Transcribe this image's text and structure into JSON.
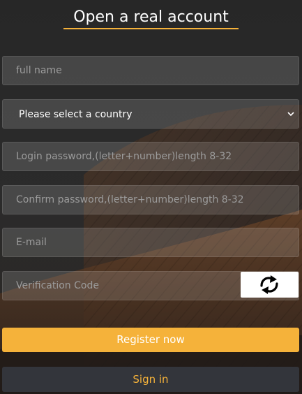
{
  "header": {
    "title": "Open a real account"
  },
  "form": {
    "full_name": {
      "placeholder": "full name",
      "value": ""
    },
    "country": {
      "selected": "Please select a country"
    },
    "login_password": {
      "placeholder": "Login password,(letter+number)length 8-32",
      "value": ""
    },
    "confirm_password": {
      "placeholder": "Confirm password,(letter+number)length 8-32",
      "value": ""
    },
    "email": {
      "placeholder": "E-mail",
      "value": ""
    },
    "verification_code": {
      "placeholder": "Verification Code",
      "value": ""
    },
    "captcha_icon": "refresh-arrows-icon"
  },
  "buttons": {
    "register": "Register now",
    "sign_in": "Sign in"
  },
  "colors": {
    "accent": "#f5b23a",
    "field_bg": "rgba(255,255,255,0.14)",
    "sign_in_bg": "#33353b"
  }
}
